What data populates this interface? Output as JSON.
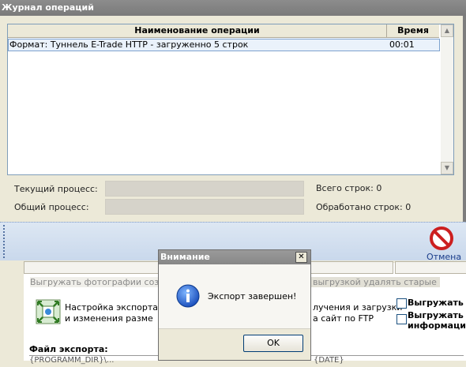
{
  "main_window": {
    "title": "Журнал операций",
    "columns": [
      "Наименование операции",
      "Время"
    ],
    "rows": [
      {
        "name": "Формат: Туннель E-Trade HTTP - загруженно 5 строк",
        "time": "00:01"
      }
    ],
    "progress": {
      "current_label": "Текущий процесс:",
      "overall_label": "Общий процесс:",
      "total_rows_label": "Всего строк: 0",
      "processed_rows_label": "Обработано строк: 0",
      "current_fraction": 0,
      "overall_fraction": 0
    },
    "cancel": {
      "label": "Отмена",
      "icon": "stop-icon",
      "color": "#cc1f1f"
    }
  },
  "background_window": {
    "photos_text": "Выгружать фотографии создан",
    "photos_text_right": "выгрузкой удалять старые",
    "export_settings_line1": "Настройка экспорта фо",
    "export_settings_line2": "и изменения разме",
    "ftp_line1": "лучения и загрузки",
    "ftp_line2": "а сайт по FTP",
    "checkbox1_label": "Выгружать д",
    "checkbox2_line1": "Выгружать и",
    "checkbox2_line2": "информацию",
    "file_label": "Файл экспорта:",
    "file_path": "{PROGRAMM_DIR}\\...",
    "file_path_right": "{DATE}"
  },
  "dialog": {
    "title": "Внимание",
    "close_glyph": "✕",
    "icon": "info-icon",
    "message": "Экспорт завершен!",
    "ok_label": "OK"
  },
  "colors": {
    "accent_blue": "#1a3c8a",
    "title_gray": "#808080",
    "info_blue": "#1f5fd1"
  }
}
